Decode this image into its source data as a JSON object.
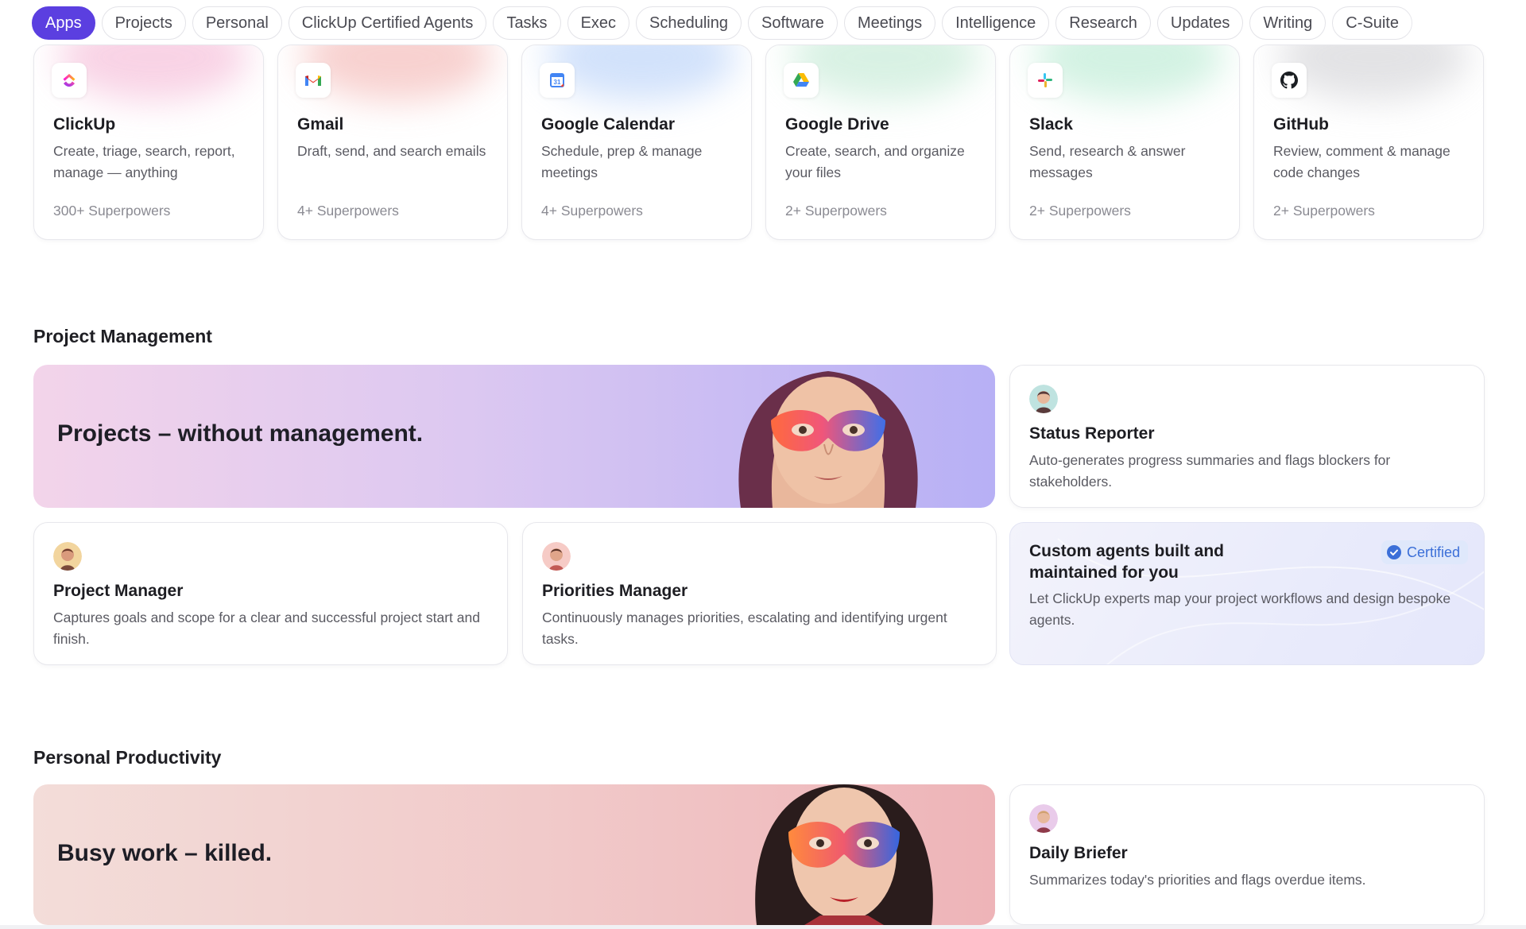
{
  "filters": [
    {
      "label": "Apps",
      "active": true
    },
    {
      "label": "Projects"
    },
    {
      "label": "Personal"
    },
    {
      "label": "ClickUp Certified Agents"
    },
    {
      "label": "Tasks"
    },
    {
      "label": "Exec"
    },
    {
      "label": "Scheduling"
    },
    {
      "label": "Software"
    },
    {
      "label": "Meetings"
    },
    {
      "label": "Intelligence"
    },
    {
      "label": "Research"
    },
    {
      "label": "Updates"
    },
    {
      "label": "Writing"
    },
    {
      "label": "C-Suite"
    }
  ],
  "apps": [
    {
      "name": "ClickUp",
      "desc": "Create, triage, search, report, manage — anything",
      "count": "300+ Superpowers",
      "icon": "clickup-logo-icon",
      "glow": "#f7c8df"
    },
    {
      "name": "Gmail",
      "desc": "Draft, send, and search emails",
      "count": "4+ Superpowers",
      "icon": "gmail-logo-icon",
      "glow": "#f6c6c4"
    },
    {
      "name": "Google Calendar",
      "desc": "Schedule, prep & manage meetings",
      "count": "4+ Superpowers",
      "icon": "google-calendar-logo-icon",
      "glow": "#c7dbfa"
    },
    {
      "name": "Google Drive",
      "desc": "Create, search, and organize your files",
      "count": "2+ Superpowers",
      "icon": "google-drive-logo-icon",
      "glow": "#cfeedd"
    },
    {
      "name": "Slack",
      "desc": "Send, research & answer messages",
      "count": "2+ Superpowers",
      "icon": "slack-logo-icon",
      "glow": "#c8efdc"
    },
    {
      "name": "GitHub",
      "desc": "Review, comment & manage code changes",
      "count": "2+ Superpowers",
      "icon": "github-logo-icon",
      "glow": "#dcdcdf"
    }
  ],
  "sections": {
    "project_management": {
      "title": "Project Management",
      "hero": "Projects – without management.",
      "status_reporter": {
        "name": "Status Reporter",
        "desc": "Auto-generates progress summaries and flags blockers for stakeholders."
      },
      "project_manager": {
        "name": "Project Manager",
        "desc": "Captures goals and scope for a clear and successful project start and finish."
      },
      "priorities_manager": {
        "name": "Priorities Manager",
        "desc": "Continuously manages priorities, escalating and identifying urgent tasks."
      },
      "custom": {
        "title": "Custom agents built and maintained for you",
        "desc": "Let ClickUp experts map your project workflows and design bespoke agents.",
        "badge": "Certified"
      }
    },
    "personal_productivity": {
      "title": "Personal Productivity",
      "hero": "Busy work – killed.",
      "daily_briefer": {
        "name": "Daily Briefer",
        "desc": "Summarizes today's priorities and flags overdue items."
      }
    }
  },
  "colors": {
    "accent": "#5b3fe0",
    "badge_text": "#3b6fd8"
  }
}
